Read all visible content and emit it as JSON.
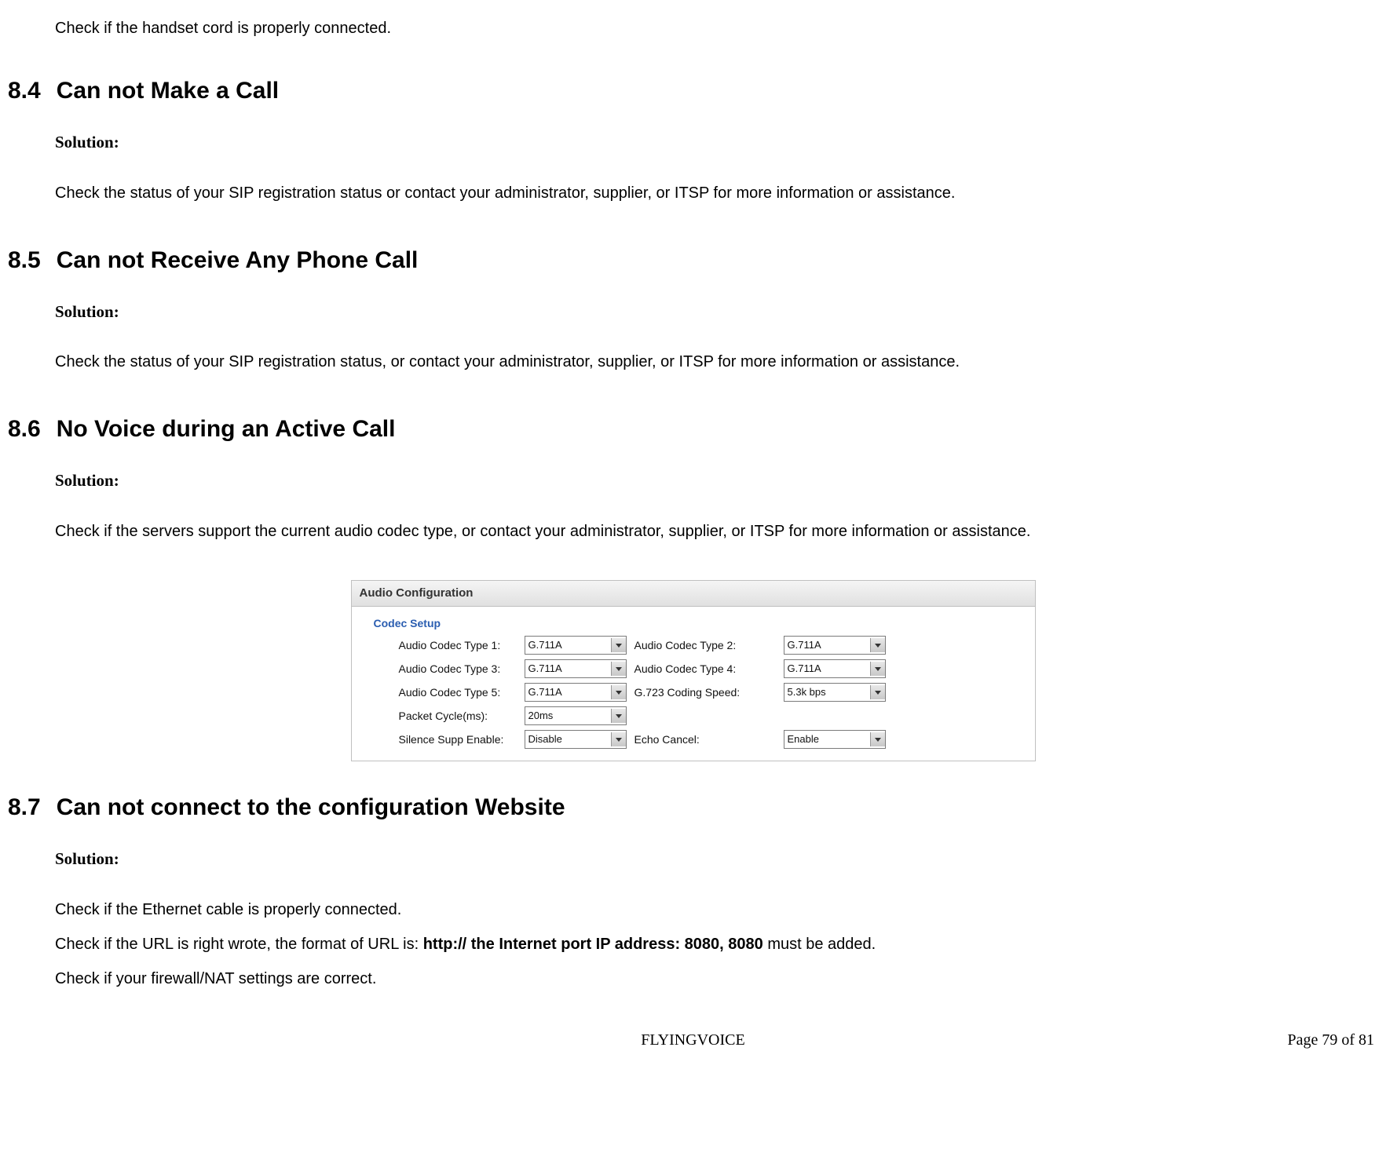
{
  "intro": "Check if the handset cord is properly connected.",
  "s84": {
    "num": "8.4",
    "title": "Can not Make a Call",
    "solution_label": "Solution:",
    "body": "Check the status of your SIP registration status or contact your administrator, supplier, or ITSP for more information or assistance."
  },
  "s85": {
    "num": "8.5",
    "title": "Can not Receive Any Phone Call",
    "solution_label": "Solution:",
    "body": "Check the status of your SIP registration status, or contact your administrator, supplier, or ITSP for more information or assistance."
  },
  "s86": {
    "num": "8.6",
    "title": "No Voice during an Active Call",
    "solution_label": "Solution:",
    "body": "Check if the servers support the current audio codec type, or contact your administrator, supplier, or ITSP for more information or assistance."
  },
  "audio": {
    "panel_title": "Audio Configuration",
    "group_label": "Codec Setup",
    "rows": {
      "r1l": "Audio Codec Type 1:",
      "r1lv": "G.711A",
      "r1r": "Audio Codec Type 2:",
      "r1rv": "G.711A",
      "r2l": "Audio Codec Type 3:",
      "r2lv": "G.711A",
      "r2r": "Audio Codec Type 4:",
      "r2rv": "G.711A",
      "r3l": "Audio Codec Type 5:",
      "r3lv": "G.711A",
      "r3r": "G.723 Coding Speed:",
      "r3rv": "5.3k bps",
      "r4l": "Packet Cycle(ms):",
      "r4lv": "20ms",
      "r5l": "Silence Supp Enable:",
      "r5lv": "Disable",
      "r5r": "Echo Cancel:",
      "r5rv": "Enable"
    }
  },
  "s87": {
    "num": "8.7",
    "title": "Can not connect to the configuration Website",
    "solution_label": "Solution:",
    "line1": "Check if the Ethernet cable is properly connected.",
    "line2a": "Check if the URL is right wrote, the format of URL is: ",
    "line2b": "http:// the Internet port IP address: 8080, 8080",
    "line2c": " must be added.",
    "line3": "Check if your firewall/NAT settings are correct."
  },
  "footer": {
    "center": "FLYINGVOICE",
    "right": "Page 79 of 81"
  }
}
